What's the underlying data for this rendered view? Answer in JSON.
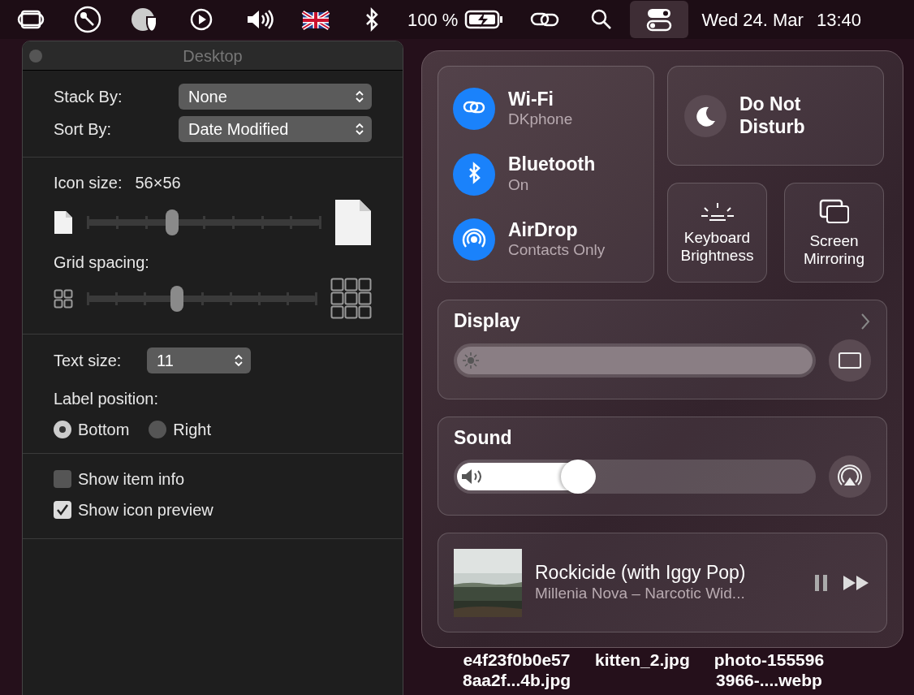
{
  "menu_bar": {
    "items": [
      {
        "kind": "screens"
      },
      {
        "kind": "key"
      },
      {
        "kind": "globe"
      },
      {
        "kind": "play"
      },
      {
        "kind": "volume"
      },
      {
        "kind": "flag"
      },
      {
        "kind": "bluetooth"
      }
    ],
    "battery": "100 %",
    "control_center_selected": true,
    "date": "Wed 24. Mar",
    "time": "13:40"
  },
  "desktop_window": {
    "title": "Desktop",
    "stack_by": {
      "label": "Stack By:",
      "value": "None"
    },
    "sort_by": {
      "label": "Sort By:",
      "value": "Date Modified"
    },
    "icon_size": {
      "label": "Icon size:",
      "value": "56×56",
      "level": 0.365
    },
    "grid_spacing": {
      "label": "Grid spacing:",
      "level": 0.39
    },
    "text_size": {
      "label": "Text size:",
      "value": "11"
    },
    "label_position": {
      "label": "Label position:",
      "options": [
        {
          "label": "Bottom",
          "selected": true
        },
        {
          "label": "Right",
          "selected": false
        }
      ]
    },
    "checkboxes": [
      {
        "label": "Show item info",
        "checked": false
      },
      {
        "label": "Show icon preview",
        "checked": true
      }
    ]
  },
  "control_center": {
    "connectivity": [
      {
        "kind": "wifi",
        "title": "Wi-Fi",
        "subtitle": "DKphone",
        "on": true
      },
      {
        "kind": "bluetooth",
        "title": "Bluetooth",
        "subtitle": "On",
        "on": true
      },
      {
        "kind": "airdrop",
        "title": "AirDrop",
        "subtitle": "Contacts Only",
        "on": true
      }
    ],
    "do_not_disturb": {
      "title": "Do Not Disturb",
      "on": false
    },
    "keyboard_brightness": {
      "title": "Keyboard Brightness"
    },
    "screen_mirroring": {
      "title": "Screen Mirroring"
    },
    "display": {
      "title": "Display",
      "level": 1
    },
    "sound": {
      "title": "Sound",
      "level": 0.39
    },
    "now_playing": {
      "title": "Rockicide (with Iggy Pop)",
      "artist": "Millenia Nova – Narcotic Wid..."
    }
  },
  "desktop_files": [
    {
      "lines": [
        "e4f23f0b0e57",
        "8aa2f...4b.jpg"
      ]
    },
    {
      "lines": [
        "kitten_2.jpg"
      ]
    },
    {
      "lines": [
        "photo-155596",
        "3966-....webp"
      ]
    }
  ]
}
